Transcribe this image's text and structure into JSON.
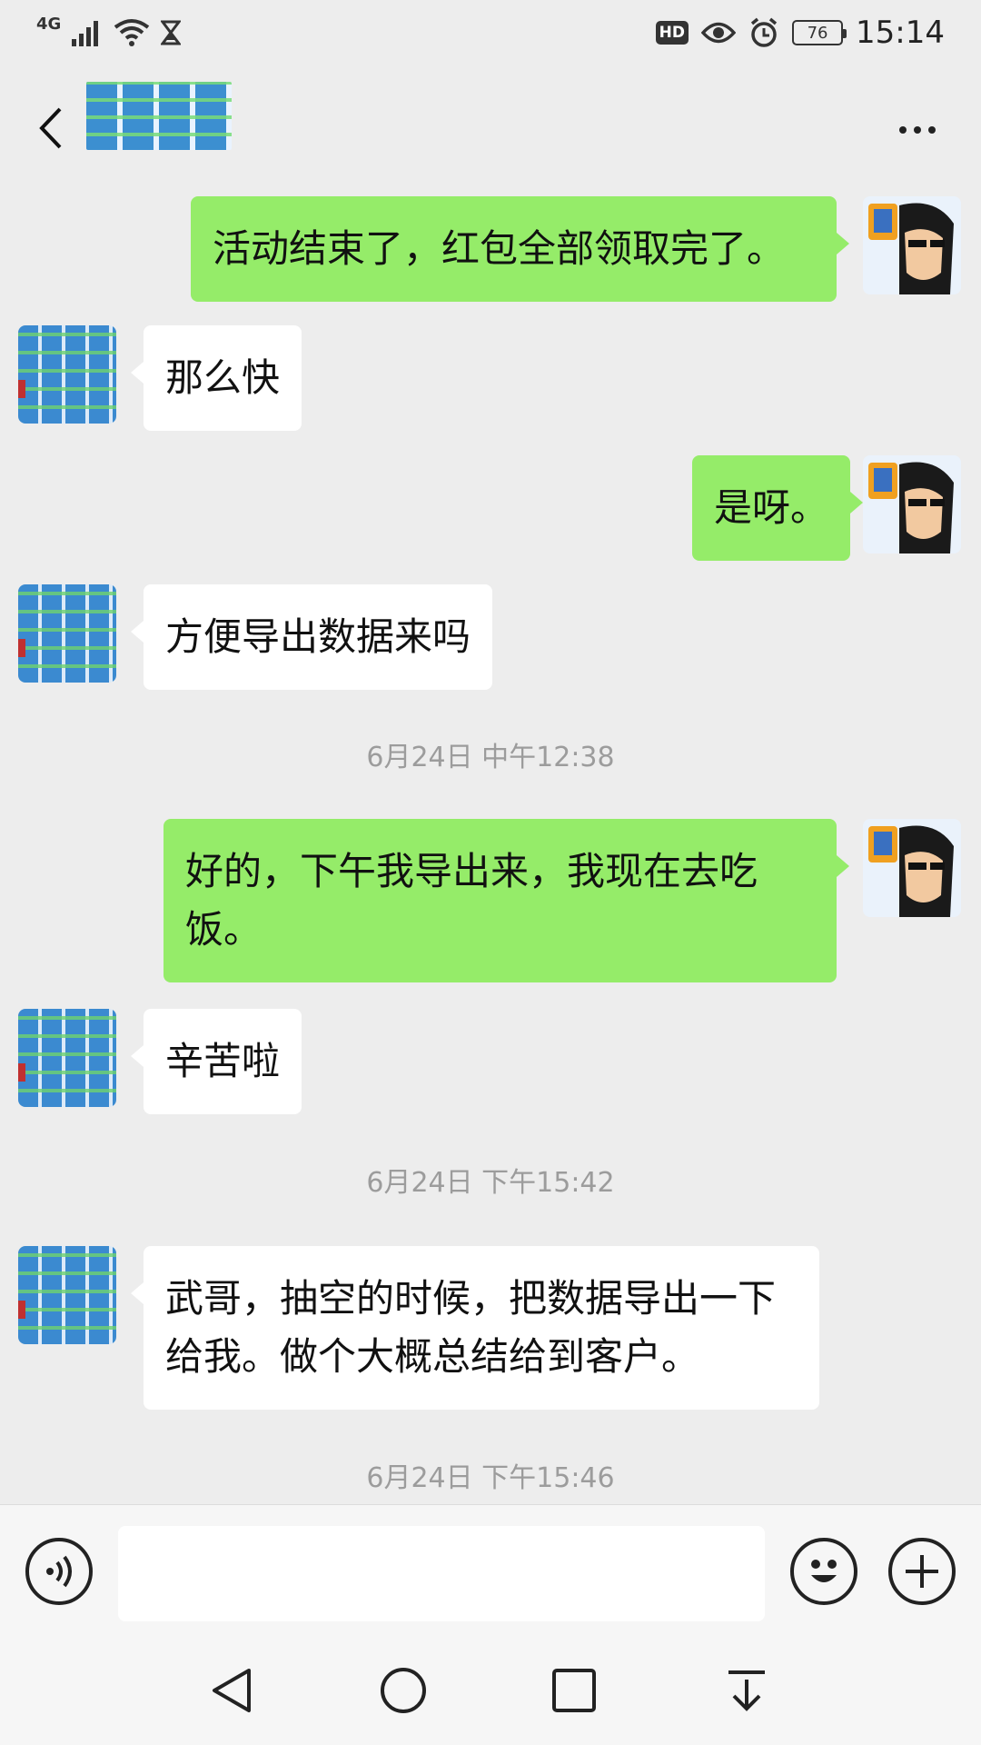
{
  "status_bar": {
    "network": "4G",
    "hd_badge": "HD",
    "battery": "76",
    "time": "15:14"
  },
  "nav": {
    "back_icon": "chevron-left-icon",
    "more_icon": "more-dots-icon"
  },
  "messages": [
    {
      "side": "me",
      "text": "活动结束了，红包全部领取完了。"
    },
    {
      "side": "other",
      "text": "那么快"
    },
    {
      "side": "me",
      "text": "是呀。"
    },
    {
      "side": "other",
      "text": "方便导出数据来吗"
    },
    {
      "type": "timestamp",
      "text": "6月24日 中午12:38"
    },
    {
      "side": "me",
      "text": "好的，下午我导出来，我现在去吃饭。"
    },
    {
      "side": "other",
      "text": "辛苦啦"
    },
    {
      "type": "timestamp",
      "text": "6月24日 下午15:42"
    },
    {
      "side": "other",
      "text": "武哥，抽空的时候，把数据导出一下给我。做个大概总结给到客户。"
    },
    {
      "type": "timestamp",
      "text": "6月24日 下午15:46"
    }
  ],
  "input_bar": {
    "value": "",
    "voice_icon": "voice-icon",
    "emoji_icon": "emoji-icon",
    "plus_icon": "plus-icon"
  },
  "system_nav": [
    "back-triangle-icon",
    "home-circle-icon",
    "recents-square-icon",
    "notification-pull-icon"
  ]
}
